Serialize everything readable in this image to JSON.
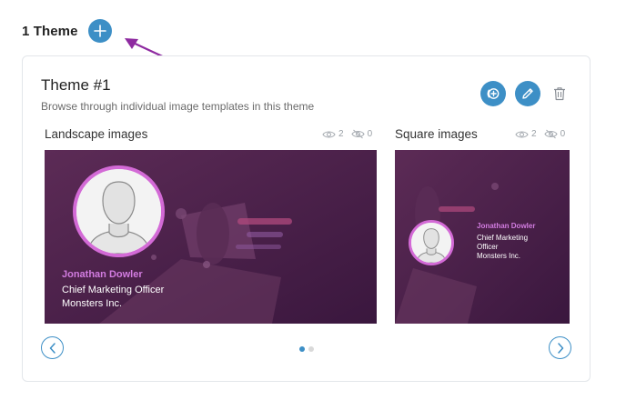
{
  "header": {
    "title": "1 Theme",
    "add_button_icon": "plus-icon"
  },
  "theme": {
    "title": "Theme #1",
    "description": "Browse through individual image templates in this theme",
    "actions": [
      {
        "icon": "add-template-icon"
      },
      {
        "icon": "pencil-icon"
      },
      {
        "icon": "trash-icon"
      }
    ]
  },
  "landscape": {
    "label": "Landscape images",
    "views": "2",
    "hidden": "0",
    "preview": {
      "name": "Jonathan Dowler",
      "role": "Chief Marketing Officer",
      "company": "Monsters Inc."
    }
  },
  "square": {
    "label": "Square images",
    "views": "2",
    "hidden": "0",
    "preview": {
      "name": "Jonathan Dowler",
      "role": "Chief Marketing",
      "role2": "Officer",
      "company": "Monsters Inc."
    }
  },
  "carousel": {
    "page_count": 2,
    "active_page": 1
  },
  "colors": {
    "accent": "#3d8fc6",
    "arrow": "#8e2aa0",
    "name_highlight": "#d27ce0",
    "preview_bg": "#4a1f49"
  }
}
